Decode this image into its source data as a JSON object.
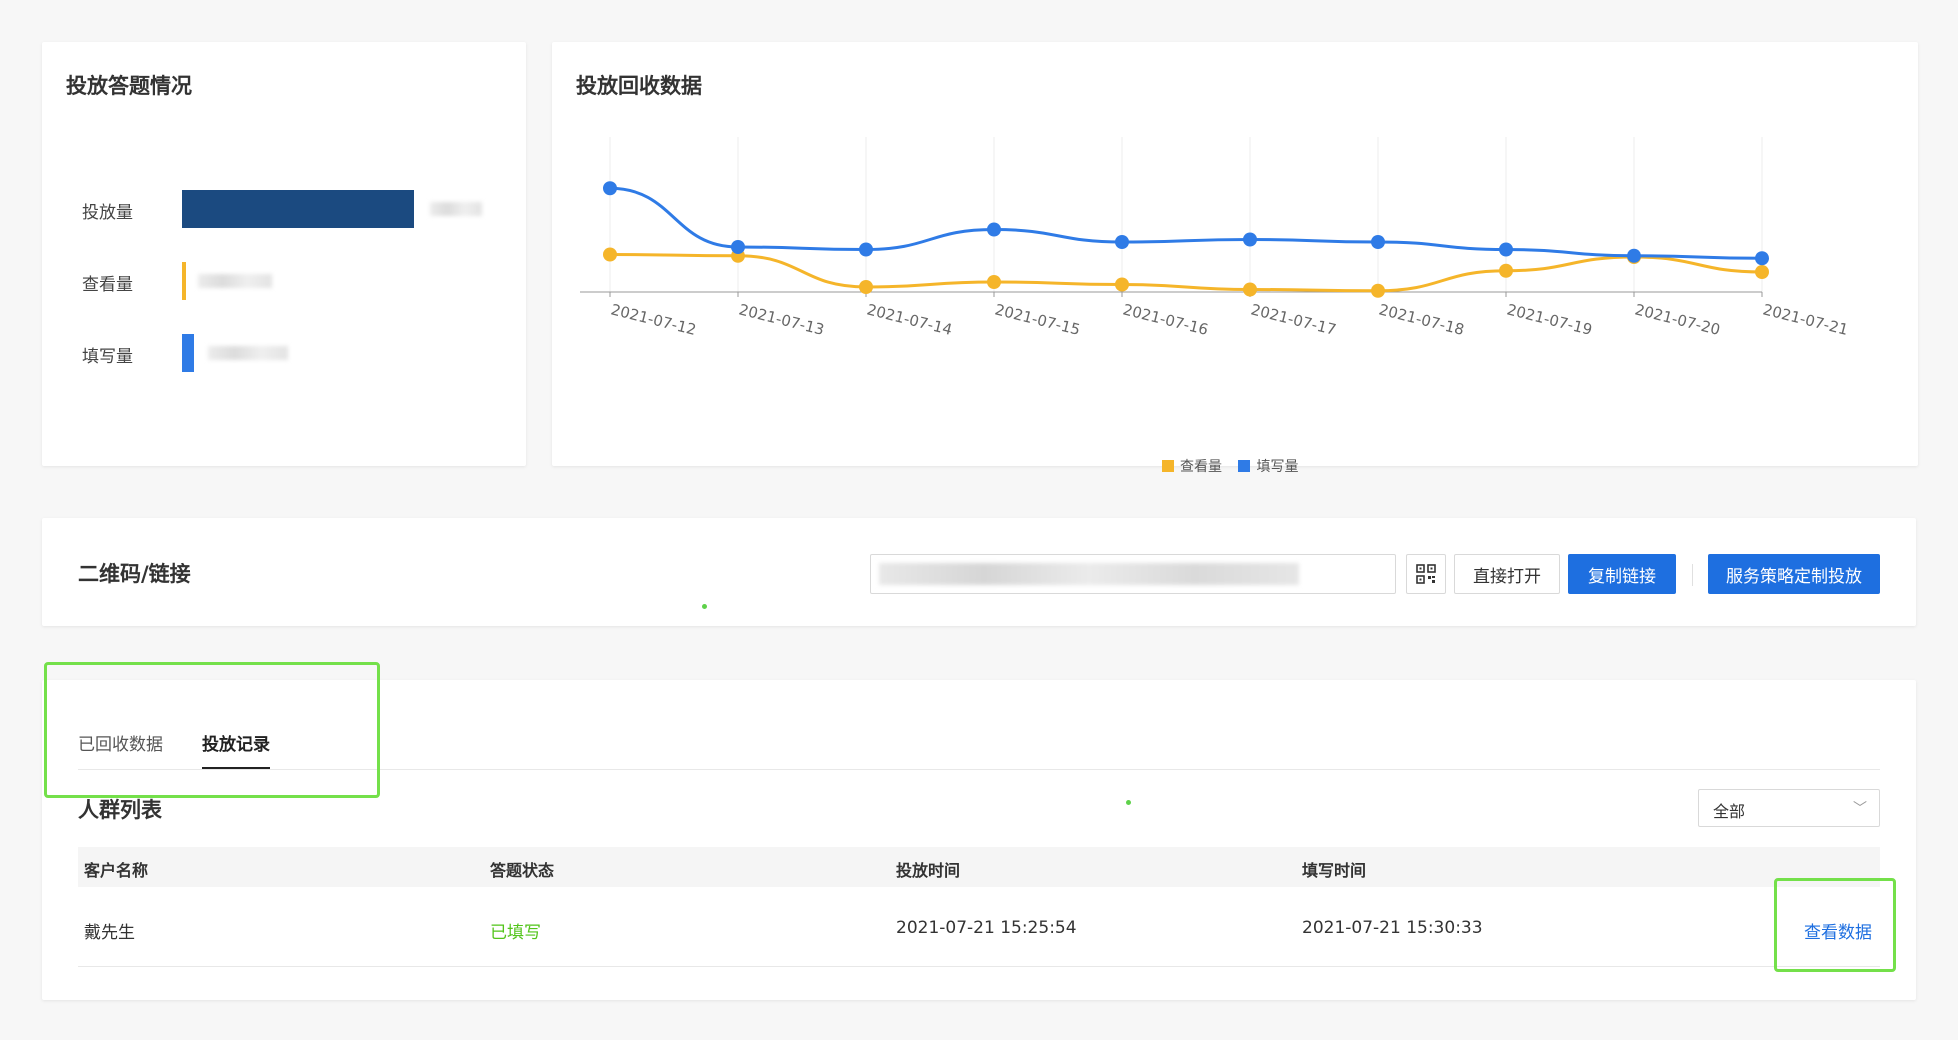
{
  "stats": {
    "title": "投放答题情况",
    "rows": [
      {
        "label": "投放量",
        "color": "#1b4a80"
      },
      {
        "label": "查看量",
        "color": "#f5b52a"
      },
      {
        "label": "填写量",
        "color": "#2f7be6"
      }
    ]
  },
  "chart_card": {
    "title": "投放回收数据"
  },
  "chart_data": {
    "type": "line",
    "categories": [
      "2021-07-12",
      "2021-07-13",
      "2021-07-14",
      "2021-07-15",
      "2021-07-16",
      "2021-07-17",
      "2021-07-18",
      "2021-07-19",
      "2021-07-20",
      "2021-07-21"
    ],
    "series": [
      {
        "name": "查看量",
        "color": "#f5b52a",
        "values": [
          30,
          29,
          4,
          8,
          6,
          2,
          1,
          17,
          28,
          16
        ]
      },
      {
        "name": "填写量",
        "color": "#2f7be6",
        "values": [
          83,
          36,
          34,
          50,
          40,
          42,
          40,
          34,
          29,
          27
        ]
      }
    ],
    "ylim": [
      0,
      100
    ],
    "legend_position": "bottom-center",
    "grid": "vertical"
  },
  "qr_card": {
    "title": "二维码/链接",
    "qr_icon": "qr-code-icon",
    "open_label": "直接打开",
    "copy_label": "复制链接",
    "custom_label": "服务策略定制投放"
  },
  "list_card": {
    "tabs": [
      {
        "label": "已回收数据"
      },
      {
        "label": "投放记录",
        "active": true
      }
    ],
    "section_title": "人群列表",
    "filter": {
      "value": "全部"
    },
    "columns": [
      "客户名称",
      "答题状态",
      "投放时间",
      "填写时间"
    ],
    "rows": [
      {
        "name": "戴先生",
        "status": "已填写",
        "status_color": "#52c41a",
        "send_time": "2021-07-21 15:25:54",
        "fill_time": "2021-07-21 15:30:33",
        "action": "查看数据"
      }
    ]
  }
}
